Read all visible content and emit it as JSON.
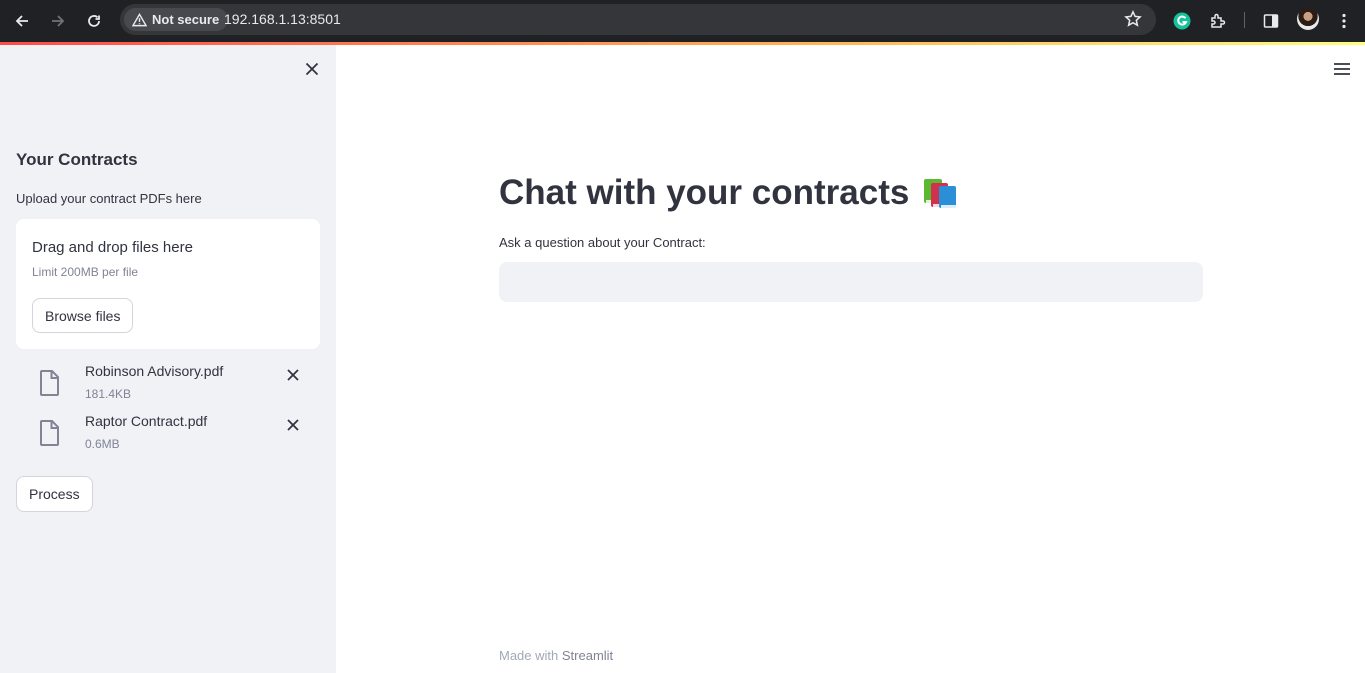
{
  "browser": {
    "security_label": "Not secure",
    "url": "192.168.1.13:8501"
  },
  "sidebar": {
    "title": "Your Contracts",
    "upload_label": "Upload your contract PDFs here",
    "dropzone": {
      "title": "Drag and drop files here",
      "limit": "Limit 200MB per file",
      "browse_label": "Browse files"
    },
    "files": [
      {
        "name": "Robinson Advisory.pdf",
        "size": "181.4KB"
      },
      {
        "name": "Raptor Contract.pdf",
        "size": "0.6MB"
      }
    ],
    "process_label": "Process"
  },
  "main": {
    "title": "Chat with your contracts",
    "question_label": "Ask a question about your Contract:",
    "question_value": ""
  },
  "footer": {
    "prefix": "Made with",
    "brand": "Streamlit"
  },
  "colors": {
    "sidebar_bg": "#f0f2f6",
    "text": "#31333f",
    "muted": "#808495",
    "header_accent": "#ff4b4b"
  }
}
